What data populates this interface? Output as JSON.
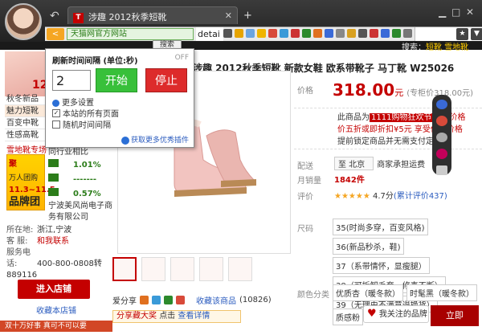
{
  "browser": {
    "tab_title": "涉趣 2012秋季短靴",
    "tab_favicon_letter": "T",
    "site_badge": "天猫网官方网站",
    "url": "detai",
    "search_value": "",
    "right_search_label": "搜索：",
    "right_search_term": "短靴 雪地靴"
  },
  "refresh_popup": {
    "title": "刷新时间间隔 (单位:秒)",
    "off_label": "OFF",
    "interval": "2",
    "start_label": "开始",
    "stop_label": "停止",
    "more_settings": "更多设置",
    "option_all_pages": "本站的所有页面",
    "option_random": "随机时间间隔",
    "more_plugins_link": "获取更多优秀插件",
    "search_tab": "搜索"
  },
  "left_col": {
    "promo_number": "12",
    "menu": [
      "秋冬新品",
      "魅力短靴",
      "百变中靴",
      "性感高靴"
    ],
    "brand_title": "雪地靴专场",
    "brand_box": {
      "l1": "聚",
      "l2": "万人团购",
      "l3": "11.3~11.5",
      "l4": "品牌团"
    },
    "stats_header": "同行业相比",
    "stats": [
      "1.01%",
      "-------",
      "0.57%"
    ],
    "company": "宁波美风尚电子商务有限公司",
    "location_label": "所在地:",
    "location": "浙江,宁波",
    "cs_label": "客 服:",
    "cs_value": "和我联系",
    "phone_label": "服务电话:",
    "phone": "400-800-0808转889116",
    "enter_shop": "进入店铺",
    "fav_shop": "收藏本店铺",
    "footer_text": "双十万好事 真可不可以要"
  },
  "product": {
    "title": "涉趣 2012秋季短靴 新款女鞋 欧系带靴子 马丁靴 W25026",
    "price_label": "价格",
    "price": "318.00",
    "price_unit": "元",
    "orig_price": "(专柜价318.00元)",
    "promo_line1_a": "此商品为",
    "promo_line1_tag": "1111购物狂欢节",
    "promo_line1_b": "专门价格",
    "promo_line2": "价五折或即折扣¥5元 享受优惠价格",
    "promo_line3": "提前锁定商品并无需支付定金",
    "ship_label": "配送",
    "ship_to": "至 北京",
    "ship_note": "商家承担运费",
    "sales_label": "月销量",
    "sales": "1842件",
    "rating_label": "评价",
    "rating": "4.7分",
    "rating_count": "(累计评价437)",
    "size_label": "尺码",
    "sizes": [
      "35(时尚多穿，百变风格)",
      "36(新品秒杀，鞋)",
      "37（系带情怀，显瘦腿）",
      "38（可拆卸毛套，修喜不断）",
      "39（无理由不满意退换货）"
    ],
    "color_label": "颜色分类",
    "colors": [
      "优质杏（暖冬款）",
      "时髦黑（暖冬款）",
      "质感粉"
    ],
    "share_label": "爱分享",
    "fav_item": "收藏该商品",
    "fav_count": "(10826)",
    "share_bar": "分享藏大奖",
    "share_action": "点击",
    "share_see": "查看详情",
    "brand_pill": "我关注的品牌",
    "buy": "立即"
  }
}
